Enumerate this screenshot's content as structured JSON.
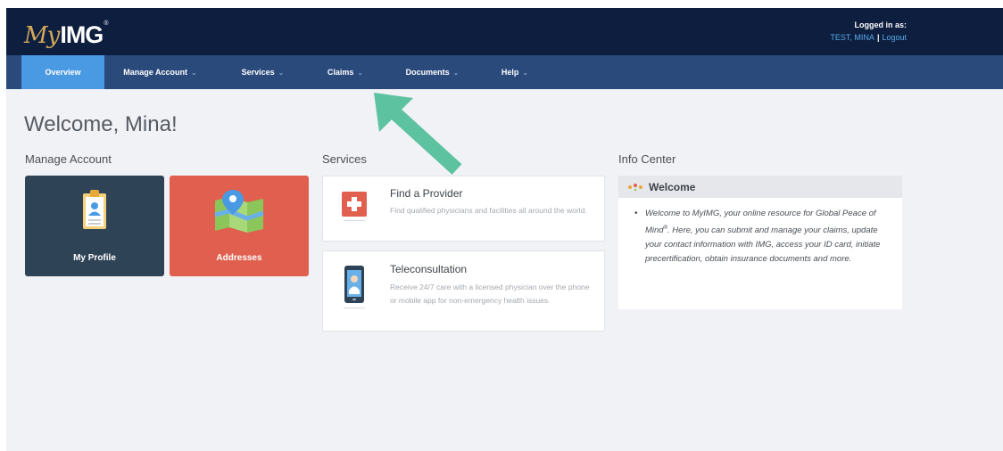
{
  "header": {
    "logo": {
      "script": "My",
      "strong": "IMG",
      "reg": "®"
    },
    "login_title": "Logged in as:",
    "user_name": "TEST, MINA",
    "separator": "|",
    "logout_label": "Logout"
  },
  "nav": {
    "items": [
      {
        "label": "Overview",
        "has_dropdown": false,
        "active": true
      },
      {
        "label": "Manage Account",
        "has_dropdown": true,
        "active": false
      },
      {
        "label": "Services",
        "has_dropdown": true,
        "active": false
      },
      {
        "label": "Claims",
        "has_dropdown": true,
        "active": false
      },
      {
        "label": "Documents",
        "has_dropdown": true,
        "active": false
      },
      {
        "label": "Help",
        "has_dropdown": true,
        "active": false
      }
    ]
  },
  "main": {
    "welcome": "Welcome, Mina!",
    "manage_account": {
      "title": "Manage Account",
      "tiles": [
        {
          "label": "My Profile",
          "icon": "clipboard-profile-icon"
        },
        {
          "label": "Addresses",
          "icon": "map-pin-icon"
        }
      ]
    },
    "services": {
      "title": "Services",
      "cards": [
        {
          "title": "Find a Provider",
          "description": "Find qualified physicians and facilities all around the world.",
          "icon": "medical-cross-icon"
        },
        {
          "title": "Teleconsultation",
          "description": "Receive 24/7 care with a licensed physician over the phone or mobile app for non-emergency health issues.",
          "icon": "phone-doctor-icon"
        }
      ]
    },
    "info_center": {
      "title": "Info Center",
      "heading": "Welcome",
      "bullet": "•",
      "text_part1": "Welcome to MyIMG, your online resource for Global Peace of Mind",
      "text_sup": "®",
      "text_part2": ". Here, you can submit and manage your claims, update your contact information with IMG, access your ID card, initiate precertification, obtain insurance documents and more."
    }
  },
  "colors": {
    "header_bg": "#0d1e3f",
    "nav_bg": "#2b4a7c",
    "nav_active": "#4a9ae3",
    "profile_tile": "#2f4357",
    "addresses_tile": "#e05f4e",
    "arrow": "#5cc2a0"
  }
}
